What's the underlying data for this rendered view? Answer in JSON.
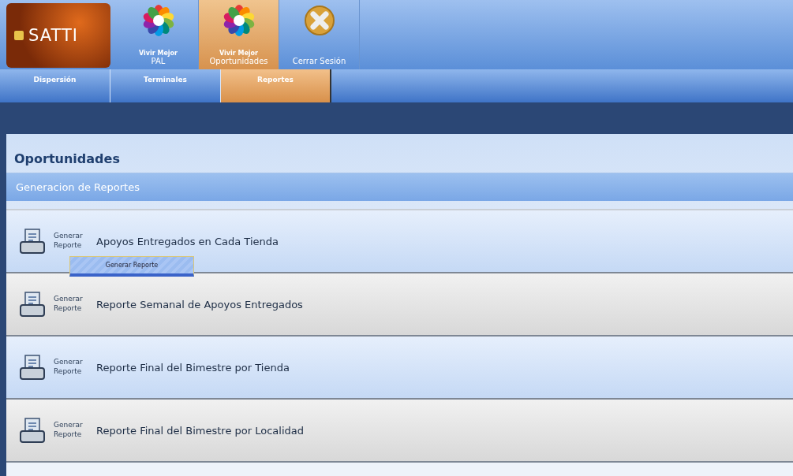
{
  "top_nav": [
    {
      "kind": "logo-tile",
      "caption": "Vivir Mejor",
      "label": "PAL",
      "selected": false
    },
    {
      "kind": "logo-tile",
      "caption": "Vivir Mejor",
      "label": "Oportunidades",
      "selected": true
    },
    {
      "kind": "close-tile",
      "label": "Cerrar Sesión",
      "selected": false
    }
  ],
  "brand": "SATTI",
  "tabs": [
    {
      "label": "Dispersión",
      "selected": false
    },
    {
      "label": "Terminales",
      "selected": false
    },
    {
      "label": "Reportes",
      "selected": true
    }
  ],
  "page_title": "Oportunidades",
  "section_title": "Generacion de Reportes",
  "reports": [
    {
      "action": "Generar Reporte",
      "title": "Apoyos Entregados en Cada Tienda",
      "tooltip": "Generar Reporte"
    },
    {
      "action": "Generar Reporte",
      "title": "Reporte Semanal de Apoyos Entregados"
    },
    {
      "action": "Generar Reporte",
      "title": "Reporte Final del Bimestre por Tienda"
    },
    {
      "action": "Generar Reporte",
      "title": "Reporte Final del Bimestre por Localidad"
    }
  ]
}
